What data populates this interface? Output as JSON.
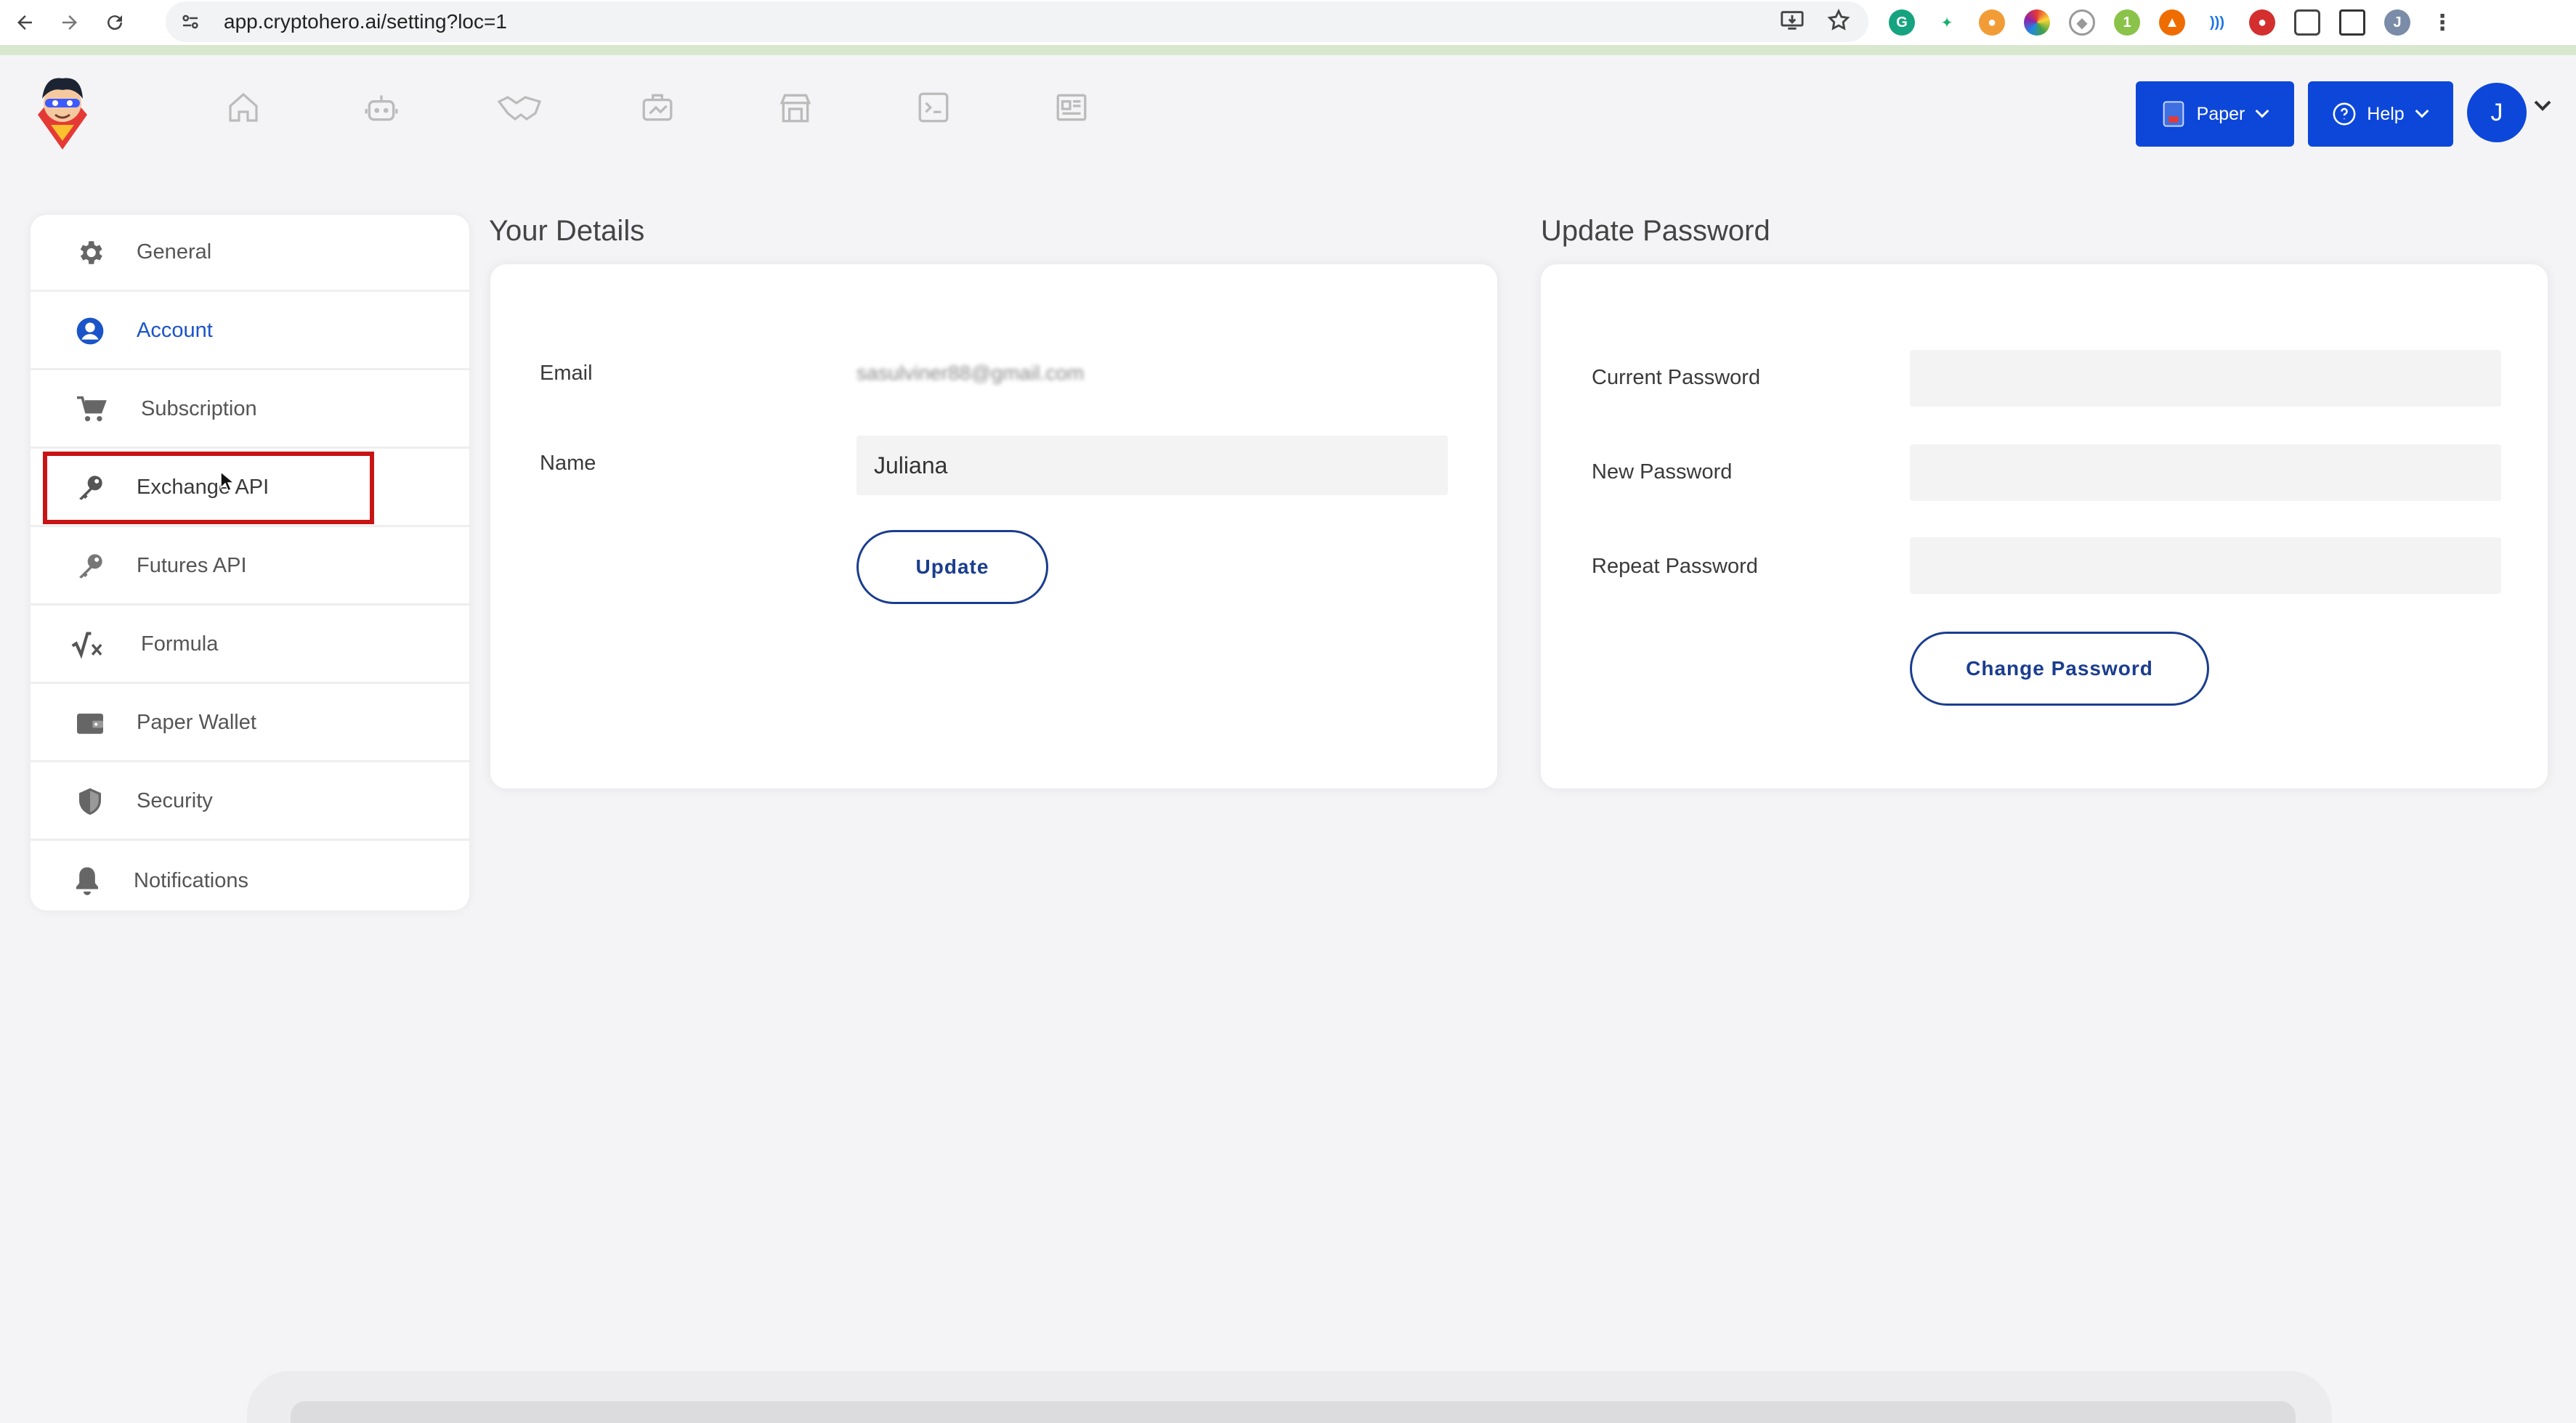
{
  "browser": {
    "url": "app.cryptohero.ai/setting?loc=1",
    "profile_initial": "J"
  },
  "header": {
    "nav_icons": [
      "home-icon",
      "robot-icon",
      "handshake-icon",
      "portfolio-icon",
      "marketplace-icon",
      "terminal-icon",
      "news-icon"
    ],
    "mode_button": "Paper",
    "help_button": "Help",
    "avatar_initial": "J",
    "accent_color": "#0d47d9"
  },
  "sidebar": {
    "items": [
      {
        "label": "General",
        "icon": "gear-icon"
      },
      {
        "label": "Account",
        "icon": "user-circle-icon"
      },
      {
        "label": "Subscription",
        "icon": "cart-icon"
      },
      {
        "label": "Exchange API",
        "icon": "key-icon"
      },
      {
        "label": "Futures API",
        "icon": "key-icon"
      },
      {
        "label": "Formula",
        "icon": "formula-icon"
      },
      {
        "label": "Paper Wallet",
        "icon": "wallet-icon"
      },
      {
        "label": "Security",
        "icon": "shield-icon"
      },
      {
        "label": "Notifications",
        "icon": "bell-icon"
      }
    ],
    "active_item": "Account",
    "highlighted_item": "Exchange API",
    "highlight_color": "#c81414"
  },
  "details": {
    "title": "Your Details",
    "email_label": "Email",
    "email_value": "sasulviner88@gmail.com",
    "name_label": "Name",
    "name_value": "Juliana",
    "update_button": "Update"
  },
  "password": {
    "title": "Update Password",
    "current_label": "Current Password",
    "new_label": "New Password",
    "repeat_label": "Repeat Password",
    "change_button": "Change Password"
  }
}
